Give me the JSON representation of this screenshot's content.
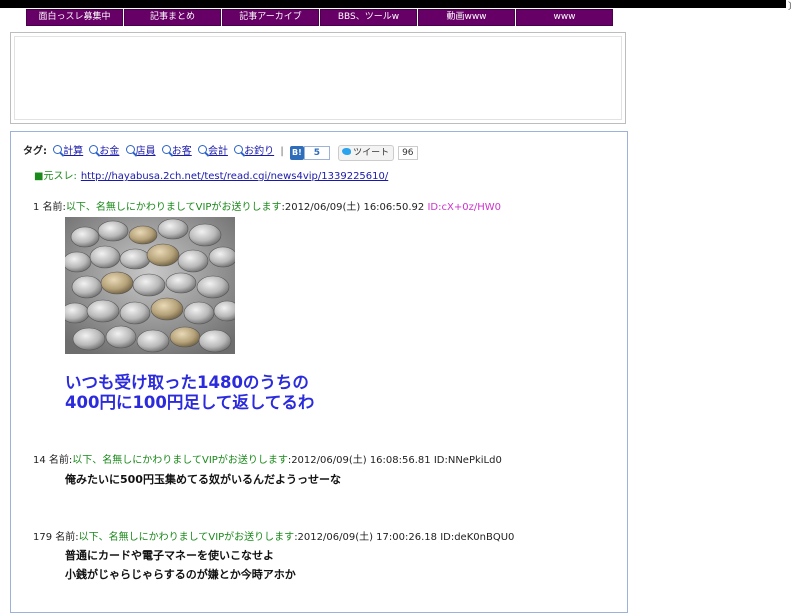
{
  "nav": {
    "items": [
      {
        "label": "面白っスレ募集中"
      },
      {
        "label": "記事まとめ"
      },
      {
        "label": "記事アーカイブ"
      },
      {
        "label": "BBS、ツールw"
      },
      {
        "label": "動画www"
      },
      {
        "label": "www"
      }
    ]
  },
  "tags": {
    "label": "タグ:",
    "items": [
      "計算",
      "お金",
      "店員",
      "お客",
      "会計",
      "お釣り"
    ],
    "separator": "|",
    "hatena_label": "B!",
    "hatena_count": "5",
    "tweet_label": "ツイート",
    "tweet_count": "96"
  },
  "source": {
    "label": "■元スレ:",
    "url": "http://hayabusa.2ch.net/test/read.cgi/news4vip/1339225610/"
  },
  "posts": [
    {
      "number": "1",
      "name_label": "名前:",
      "name": "以下、名無しにかわりましてVIPがお送りします",
      "datetime": ":2012/06/09(土) 16:06:50.92",
      "id": "ID:cX+0z/HW0",
      "lines": [
        "いつも受け取った1480のうちの",
        "400円に100円足して返してるわ"
      ]
    },
    {
      "number": "14",
      "name_label": "名前:",
      "name": "以下、名無しにかわりましてVIPがお送りします",
      "datetime": ":2012/06/09(土) 16:08:56.81",
      "id": "ID:NNePkiLd0",
      "lines": [
        "俺みたいに500円玉集めてる奴がいるんだようっせーな"
      ]
    },
    {
      "number": "179",
      "name_label": "名前:",
      "name": "以下、名無しにかわりましてVIPがお送りします",
      "datetime": ":2012/06/09(土) 17:00:26.18",
      "id": "ID:deK0nBQU0",
      "lines": [
        "普通にカードや電子マネーを使いこなせよ",
        "小銭がじゃらじゃらするのが嫌とか今時アホか"
      ]
    }
  ],
  "colors": {
    "nav_bg": "#660066",
    "name_green": "#1a8a1a",
    "link_blue": "#1a1aaa",
    "big_text_blue": "#2b2bdd",
    "id_pink": "#cc33cc"
  },
  "icons": {
    "tag_icon": "magnifier-icon",
    "hatena_icon": "hatena-bookmark-icon",
    "tweet_icon": "twitter-bird-icon"
  }
}
